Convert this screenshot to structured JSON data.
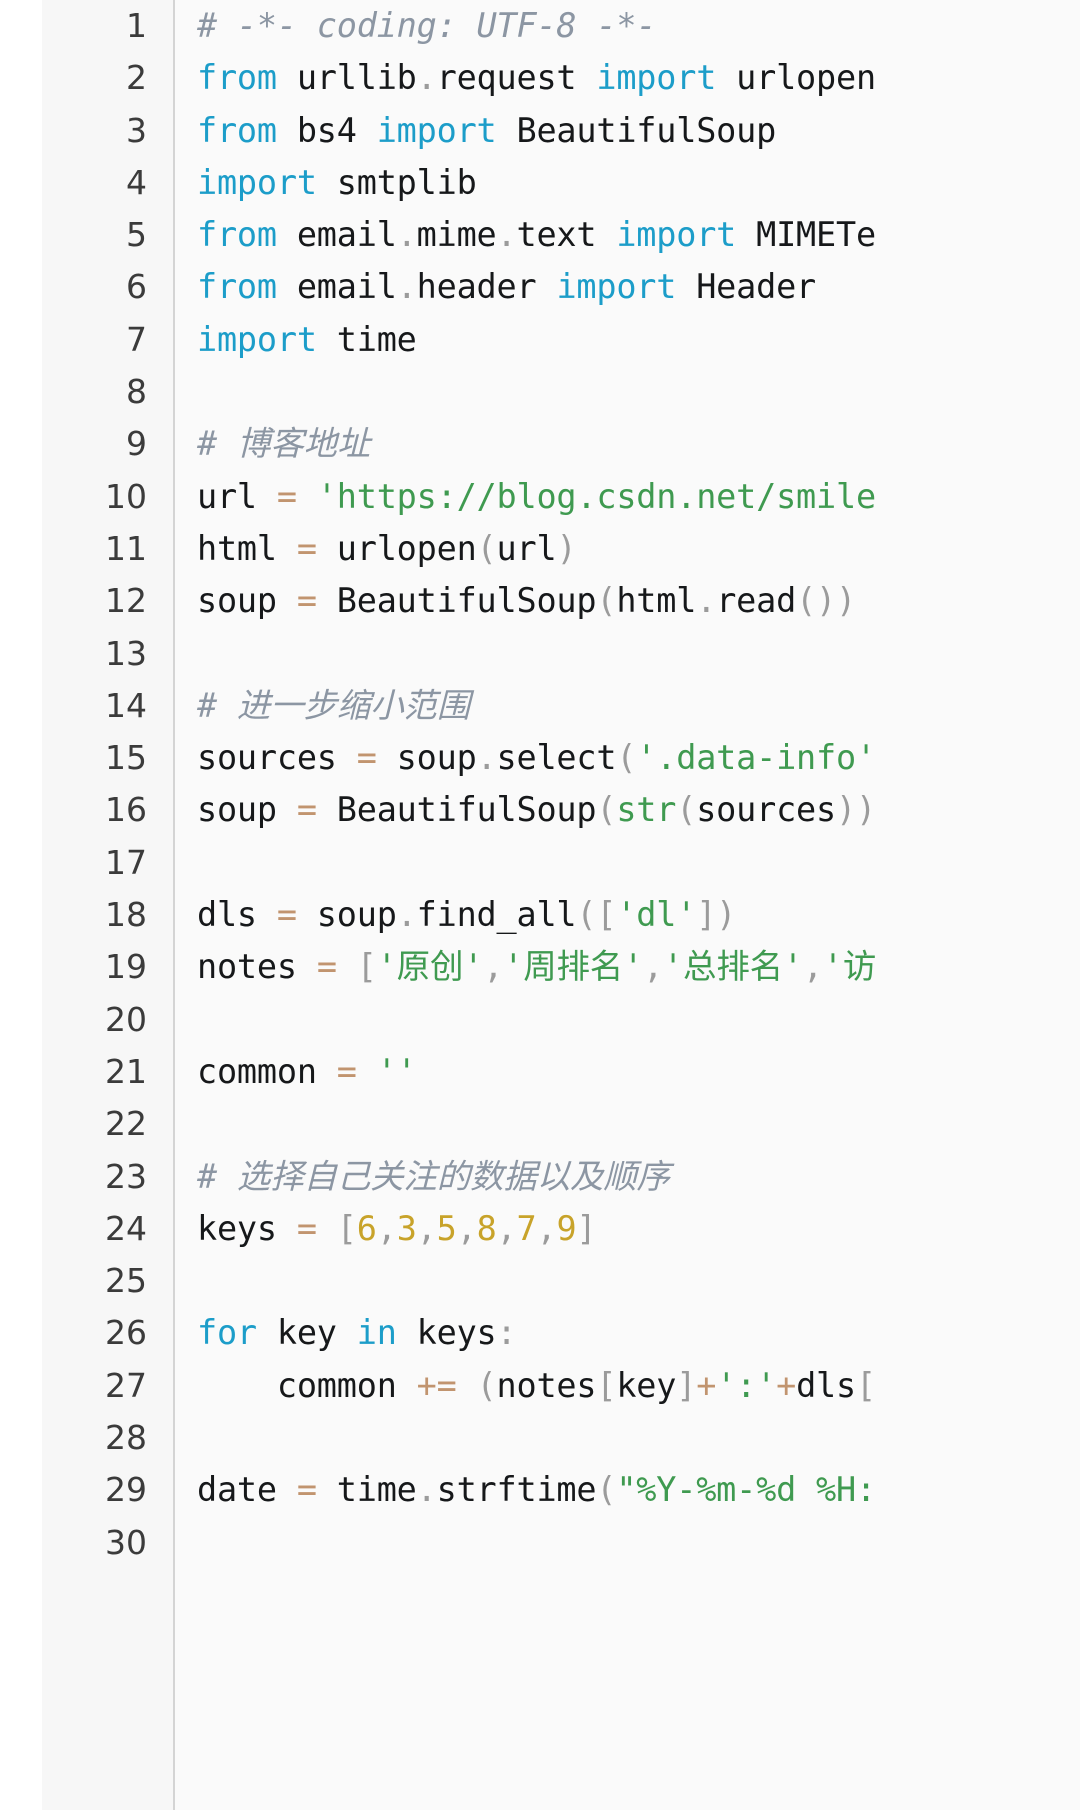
{
  "editor": {
    "language": "Python",
    "visible_line_count": 30,
    "first_visible_line": 1,
    "last_visible_line": 30,
    "wrap_enabled": false,
    "theme": "light"
  },
  "colors": {
    "background": "#fafafa",
    "gutter_background": "#f7f7f7",
    "gutter_divider": "#d4d4d4",
    "line_number": "#3b3b3b",
    "default_text": "#16181a",
    "keyword": "#1c9dc9",
    "string": "#3f9a50",
    "comment": "#8c96a3",
    "operator": "#c1946f",
    "number": "#c8a32a",
    "punctuation": "#9b9b9b"
  },
  "gutter": {
    "line_numbers": [
      "1",
      "2",
      "3",
      "4",
      "5",
      "6",
      "7",
      "8",
      "9",
      "10",
      "11",
      "12",
      "13",
      "14",
      "15",
      "16",
      "17",
      "18",
      "19",
      "20",
      "21",
      "22",
      "23",
      "24",
      "25",
      "26",
      "27",
      "28",
      "29",
      "30"
    ]
  },
  "code": {
    "lines": [
      {
        "number": "1",
        "text": "# -*- coding: UTF-8 -*-",
        "tokens": [
          {
            "t": "# -*- coding: UTF-8 -*-",
            "c": "com"
          }
        ]
      },
      {
        "number": "2",
        "text": "from urllib.request import urlopen",
        "tokens": [
          {
            "t": "from",
            "c": "kw"
          },
          {
            "t": " urllib",
            "c": "txt"
          },
          {
            "t": ".",
            "c": "dot"
          },
          {
            "t": "request ",
            "c": "txt"
          },
          {
            "t": "import",
            "c": "kw"
          },
          {
            "t": " urlopen",
            "c": "txt"
          }
        ]
      },
      {
        "number": "3",
        "text": "from bs4 import BeautifulSoup",
        "tokens": [
          {
            "t": "from",
            "c": "kw"
          },
          {
            "t": " bs4 ",
            "c": "txt"
          },
          {
            "t": "import",
            "c": "kw"
          },
          {
            "t": " BeautifulSoup",
            "c": "txt"
          }
        ]
      },
      {
        "number": "4",
        "text": "import smtplib",
        "tokens": [
          {
            "t": "import",
            "c": "kw"
          },
          {
            "t": " smtplib",
            "c": "txt"
          }
        ]
      },
      {
        "number": "5",
        "text": "from email.mime.text import MIMETe",
        "truncated": true,
        "tokens": [
          {
            "t": "from",
            "c": "kw"
          },
          {
            "t": " email",
            "c": "txt"
          },
          {
            "t": ".",
            "c": "dot"
          },
          {
            "t": "mime",
            "c": "txt"
          },
          {
            "t": ".",
            "c": "dot"
          },
          {
            "t": "text ",
            "c": "txt"
          },
          {
            "t": "import",
            "c": "kw"
          },
          {
            "t": " MIMETe",
            "c": "txt"
          }
        ]
      },
      {
        "number": "6",
        "text": "from email.header import Header",
        "tokens": [
          {
            "t": "from",
            "c": "kw"
          },
          {
            "t": " email",
            "c": "txt"
          },
          {
            "t": ".",
            "c": "dot"
          },
          {
            "t": "header ",
            "c": "txt"
          },
          {
            "t": "import",
            "c": "kw"
          },
          {
            "t": " Header",
            "c": "txt"
          }
        ]
      },
      {
        "number": "7",
        "text": "import time",
        "tokens": [
          {
            "t": "import",
            "c": "kw"
          },
          {
            "t": " time",
            "c": "txt"
          }
        ]
      },
      {
        "number": "8",
        "text": "",
        "tokens": []
      },
      {
        "number": "9",
        "text": "# 博客地址",
        "tokens": [
          {
            "t": "# 博客地址",
            "c": "com"
          }
        ]
      },
      {
        "number": "10",
        "text": "url = 'https://blog.csdn.net/smile",
        "truncated": true,
        "tokens": [
          {
            "t": "url ",
            "c": "txt"
          },
          {
            "t": "=",
            "c": "op"
          },
          {
            "t": " ",
            "c": "txt"
          },
          {
            "t": "'https://blog.csdn.net/smile",
            "c": "str"
          }
        ]
      },
      {
        "number": "11",
        "text": "html = urlopen(url)",
        "tokens": [
          {
            "t": "html ",
            "c": "txt"
          },
          {
            "t": "=",
            "c": "op"
          },
          {
            "t": " urlopen",
            "c": "txt"
          },
          {
            "t": "(",
            "c": "pun"
          },
          {
            "t": "url",
            "c": "txt"
          },
          {
            "t": ")",
            "c": "pun"
          }
        ]
      },
      {
        "number": "12",
        "text": "soup = BeautifulSoup(html.read())",
        "tokens": [
          {
            "t": "soup ",
            "c": "txt"
          },
          {
            "t": "=",
            "c": "op"
          },
          {
            "t": " BeautifulSoup",
            "c": "txt"
          },
          {
            "t": "(",
            "c": "pun"
          },
          {
            "t": "html",
            "c": "txt"
          },
          {
            "t": ".",
            "c": "dot"
          },
          {
            "t": "read",
            "c": "txt"
          },
          {
            "t": "()",
            "c": "pun"
          },
          {
            "t": ")",
            "c": "pun"
          }
        ]
      },
      {
        "number": "13",
        "text": "",
        "tokens": []
      },
      {
        "number": "14",
        "text": "# 进一步缩小范围",
        "tokens": [
          {
            "t": "# 进一步缩小范围",
            "c": "com"
          }
        ]
      },
      {
        "number": "15",
        "text": "sources = soup.select('.data-info'",
        "truncated": true,
        "tokens": [
          {
            "t": "sources ",
            "c": "txt"
          },
          {
            "t": "=",
            "c": "op"
          },
          {
            "t": " soup",
            "c": "txt"
          },
          {
            "t": ".",
            "c": "dot"
          },
          {
            "t": "select",
            "c": "txt"
          },
          {
            "t": "(",
            "c": "pun"
          },
          {
            "t": "'.data-info'",
            "c": "str"
          }
        ]
      },
      {
        "number": "16",
        "text": "soup = BeautifulSoup(str(sources))",
        "tokens": [
          {
            "t": "soup ",
            "c": "txt"
          },
          {
            "t": "=",
            "c": "op"
          },
          {
            "t": " BeautifulSoup",
            "c": "txt"
          },
          {
            "t": "(",
            "c": "pun"
          },
          {
            "t": "str",
            "c": "str"
          },
          {
            "t": "(",
            "c": "pun"
          },
          {
            "t": "sources",
            "c": "txt"
          },
          {
            "t": "))",
            "c": "pun"
          }
        ]
      },
      {
        "number": "17",
        "text": "",
        "tokens": []
      },
      {
        "number": "18",
        "text": "dls = soup.find_all(['dl'])",
        "tokens": [
          {
            "t": "dls ",
            "c": "txt"
          },
          {
            "t": "=",
            "c": "op"
          },
          {
            "t": " soup",
            "c": "txt"
          },
          {
            "t": ".",
            "c": "dot"
          },
          {
            "t": "find_all",
            "c": "txt"
          },
          {
            "t": "([",
            "c": "pun"
          },
          {
            "t": "'dl'",
            "c": "str"
          },
          {
            "t": "])",
            "c": "pun"
          }
        ]
      },
      {
        "number": "19",
        "text": "notes = ['原创','周排名','总排名','访",
        "truncated": true,
        "tokens": [
          {
            "t": "notes ",
            "c": "txt"
          },
          {
            "t": "=",
            "c": "op"
          },
          {
            "t": " ",
            "c": "txt"
          },
          {
            "t": "[",
            "c": "pun"
          },
          {
            "t": "'原创'",
            "c": "str"
          },
          {
            "t": ",",
            "c": "pun"
          },
          {
            "t": "'周排名'",
            "c": "str"
          },
          {
            "t": ",",
            "c": "pun"
          },
          {
            "t": "'总排名'",
            "c": "str"
          },
          {
            "t": ",",
            "c": "pun"
          },
          {
            "t": "'访",
            "c": "str"
          }
        ]
      },
      {
        "number": "20",
        "text": "",
        "tokens": []
      },
      {
        "number": "21",
        "text": "common = ''",
        "tokens": [
          {
            "t": "common ",
            "c": "txt"
          },
          {
            "t": "=",
            "c": "op"
          },
          {
            "t": " ",
            "c": "txt"
          },
          {
            "t": "''",
            "c": "str"
          }
        ]
      },
      {
        "number": "22",
        "text": "",
        "tokens": []
      },
      {
        "number": "23",
        "text": "# 选择自己关注的数据以及顺序",
        "tokens": [
          {
            "t": "# 选择自己关注的数据以及顺序",
            "c": "com"
          }
        ]
      },
      {
        "number": "24",
        "text": "keys = [6,3,5,8,7,9]",
        "tokens": [
          {
            "t": "keys ",
            "c": "txt"
          },
          {
            "t": "=",
            "c": "op"
          },
          {
            "t": " ",
            "c": "txt"
          },
          {
            "t": "[",
            "c": "pun"
          },
          {
            "t": "6",
            "c": "num"
          },
          {
            "t": ",",
            "c": "pun"
          },
          {
            "t": "3",
            "c": "num"
          },
          {
            "t": ",",
            "c": "pun"
          },
          {
            "t": "5",
            "c": "num"
          },
          {
            "t": ",",
            "c": "pun"
          },
          {
            "t": "8",
            "c": "num"
          },
          {
            "t": ",",
            "c": "pun"
          },
          {
            "t": "7",
            "c": "num"
          },
          {
            "t": ",",
            "c": "pun"
          },
          {
            "t": "9",
            "c": "num"
          },
          {
            "t": "]",
            "c": "pun"
          }
        ]
      },
      {
        "number": "25",
        "text": "",
        "tokens": []
      },
      {
        "number": "26",
        "text": "for key in keys:",
        "tokens": [
          {
            "t": "for",
            "c": "kw"
          },
          {
            "t": " key ",
            "c": "txt"
          },
          {
            "t": "in",
            "c": "kw"
          },
          {
            "t": " keys",
            "c": "txt"
          },
          {
            "t": ":",
            "c": "pun"
          }
        ]
      },
      {
        "number": "27",
        "text": "    common += (notes[key]+':'+dls[",
        "truncated": true,
        "tokens": [
          {
            "t": "    common ",
            "c": "txt"
          },
          {
            "t": "+=",
            "c": "op"
          },
          {
            "t": " ",
            "c": "txt"
          },
          {
            "t": "(",
            "c": "pun"
          },
          {
            "t": "notes",
            "c": "txt"
          },
          {
            "t": "[",
            "c": "pun"
          },
          {
            "t": "key",
            "c": "txt"
          },
          {
            "t": "]",
            "c": "pun"
          },
          {
            "t": "+",
            "c": "op"
          },
          {
            "t": "':'",
            "c": "str"
          },
          {
            "t": "+",
            "c": "op"
          },
          {
            "t": "dls",
            "c": "txt"
          },
          {
            "t": "[",
            "c": "pun"
          }
        ]
      },
      {
        "number": "28",
        "text": "",
        "tokens": []
      },
      {
        "number": "29",
        "text": "date = time.strftime(\"%Y-%m-%d %H:",
        "truncated": true,
        "tokens": [
          {
            "t": "date ",
            "c": "txt"
          },
          {
            "t": "=",
            "c": "op"
          },
          {
            "t": " time",
            "c": "txt"
          },
          {
            "t": ".",
            "c": "dot"
          },
          {
            "t": "strftime",
            "c": "txt"
          },
          {
            "t": "(",
            "c": "pun"
          },
          {
            "t": "\"%Y-%m-%d %H:",
            "c": "str"
          }
        ]
      },
      {
        "number": "30",
        "text": "",
        "tokens": []
      }
    ]
  }
}
